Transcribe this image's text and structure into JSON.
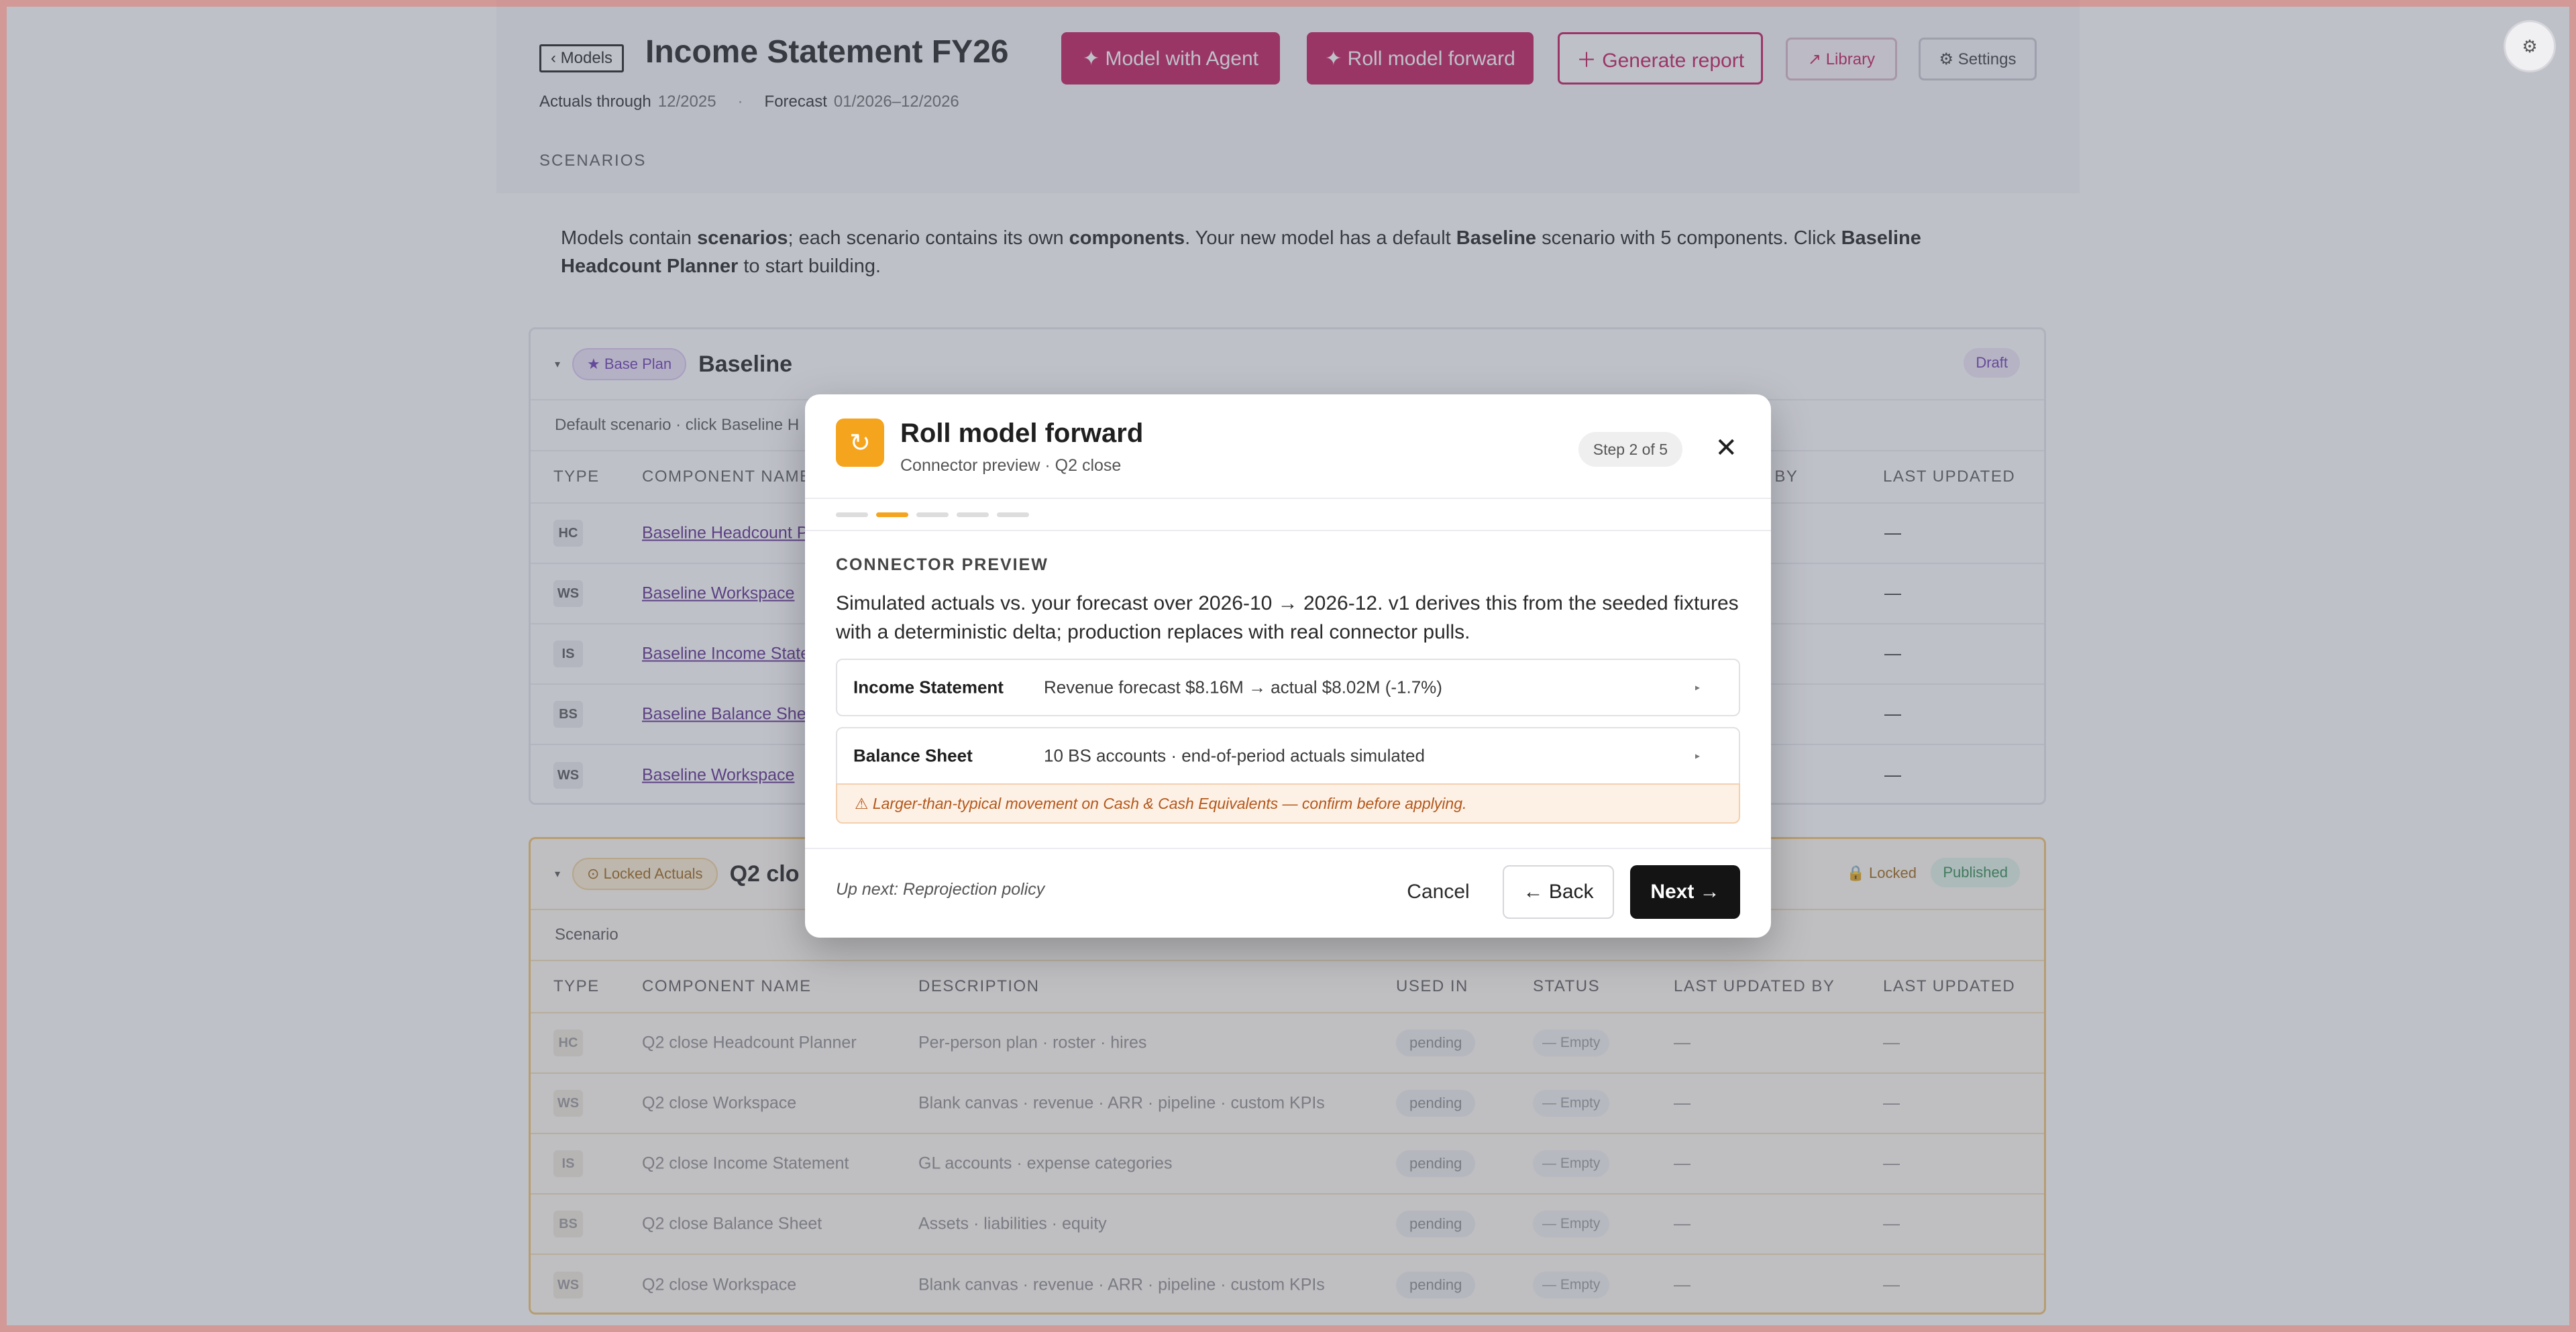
{
  "header": {
    "back_label": "‹ Models",
    "title": "Income Statement FY26",
    "actuals_label": "Actuals through",
    "actuals_value": "12/2025",
    "separator": "·",
    "forecast_label": "Forecast",
    "forecast_value": "01/2026–12/2026",
    "scenarios_label": "SCENARIOS",
    "buttons": {
      "model_with_agent": "✦ Model with Agent",
      "roll_forward": "✦ Roll model forward",
      "generate_report": "＋ Generate report",
      "library": "↗ Library",
      "settings": "⚙ Settings"
    }
  },
  "intro": {
    "p1": "Models contain ",
    "b1": "scenarios",
    "p2": "; each scenario contains its own ",
    "b2": "components",
    "p3": ". Your new model has a default ",
    "b3": "Baseline",
    "p4": " scenario with 5 components. Click ",
    "b4": "Baseline Headcount Planner",
    "p5": " to start building."
  },
  "baseline": {
    "tag": "★ Base Plan",
    "name": "Baseline",
    "status": "Draft",
    "subline": "Default scenario · click Baseline H",
    "columns": {
      "type": "TYPE",
      "name": "COMPONENT NAME",
      "updated_by": "ATED BY",
      "updated": "LAST UPDATED"
    },
    "rows": [
      {
        "type": "HC",
        "name": "Baseline Headcount P",
        "updated": "—"
      },
      {
        "type": "WS",
        "name": "Baseline Workspace",
        "updated": "—"
      },
      {
        "type": "IS",
        "name": "Baseline Income Statem",
        "updated": "—"
      },
      {
        "type": "BS",
        "name": "Baseline Balance She",
        "updated": "—"
      },
      {
        "type": "WS",
        "name": "Baseline Workspace",
        "updated": "—"
      }
    ]
  },
  "q2close": {
    "tag": "⊙ Locked Actuals",
    "name": "Q2 clo",
    "locked": "🔒 Locked",
    "status": "Published",
    "subline": "Scenario",
    "columns": {
      "type": "TYPE",
      "name": "COMPONENT NAME",
      "desc": "DESCRIPTION",
      "used": "USED IN",
      "status": "STATUS",
      "updated_by": "LAST UPDATED BY",
      "updated": "LAST UPDATED"
    },
    "rows": [
      {
        "type": "HC",
        "name": "Q2 close Headcount Planner",
        "desc": "Per-person plan · roster · hires",
        "used": "pending",
        "status": "— Empty",
        "updated_by": "—",
        "updated": "—"
      },
      {
        "type": "WS",
        "name": "Q2 close Workspace",
        "desc": "Blank canvas · revenue · ARR · pipeline · custom KPIs",
        "used": "pending",
        "status": "— Empty",
        "updated_by": "—",
        "updated": "—"
      },
      {
        "type": "IS",
        "name": "Q2 close Income Statement",
        "desc": "GL accounts · expense categories",
        "used": "pending",
        "status": "— Empty",
        "updated_by": "—",
        "updated": "—"
      },
      {
        "type": "BS",
        "name": "Q2 close Balance Sheet",
        "desc": "Assets · liabilities · equity",
        "used": "pending",
        "status": "— Empty",
        "updated_by": "—",
        "updated": "—"
      },
      {
        "type": "WS",
        "name": "Q2 close Workspace",
        "desc": "Blank canvas · revenue · ARR · pipeline · custom KPIs",
        "used": "pending",
        "status": "— Empty",
        "updated_by": "—",
        "updated": "—"
      }
    ]
  },
  "modal": {
    "icon": "refresh-icon",
    "title": "Roll model forward",
    "subtitle": "Connector preview · Q2 close",
    "step": "Step 2 of 5",
    "close": "✕",
    "progress_total": 5,
    "progress_current": 2,
    "section_label": "CONNECTOR PREVIEW",
    "description": "Simulated actuals vs. your forecast over 2026-10 → 2026-12. v1 derives this from the seeded fixtures with a deterministic delta; production replaces with real connector pulls.",
    "connectors": [
      {
        "name": "Income Statement",
        "detail": "Revenue forecast $8.16M → actual $8.02M (-1.7%)",
        "arrow": "▸"
      },
      {
        "name": "Balance Sheet",
        "detail": "10 BS accounts · end-of-period actuals simulated",
        "arrow": "▸"
      }
    ],
    "warning": "⚠ Larger-than-typical movement on Cash & Cash Equivalents — confirm before applying.",
    "up_next": "Up next: Reprojection policy",
    "cancel": "Cancel",
    "back": "← Back",
    "next": "Next →"
  },
  "colors": {
    "brand": "#c2185b",
    "accent": "#f5a41e",
    "overlay": "rgba(95,100,120,0.40)"
  },
  "floating_button": {
    "icon": "gear-icon",
    "glyph": "⚙"
  }
}
